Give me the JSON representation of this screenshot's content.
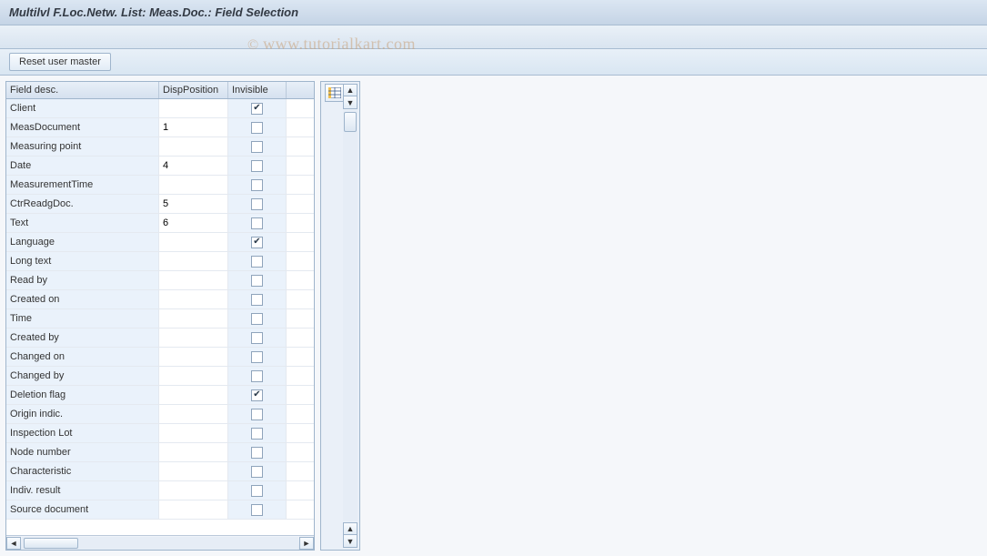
{
  "window": {
    "title": "Multilvl F.Loc.Netw. List: Meas.Doc.: Field Selection"
  },
  "toolbar": {
    "reset_label": "Reset user master"
  },
  "table": {
    "headers": {
      "field": "Field desc.",
      "disp": "DispPosition",
      "inv": "Invisible"
    },
    "rows": [
      {
        "field": "Client",
        "disp": "",
        "inv": true
      },
      {
        "field": "MeasDocument",
        "disp": "1",
        "inv": false
      },
      {
        "field": "Measuring point",
        "disp": "",
        "inv": false
      },
      {
        "field": "Date",
        "disp": "4",
        "inv": false
      },
      {
        "field": "MeasurementTime",
        "disp": "",
        "inv": false
      },
      {
        "field": "CtrReadgDoc.",
        "disp": "5",
        "inv": false
      },
      {
        "field": "Text",
        "disp": "6",
        "inv": false
      },
      {
        "field": "Language",
        "disp": "",
        "inv": true
      },
      {
        "field": "Long text",
        "disp": "",
        "inv": false
      },
      {
        "field": "Read by",
        "disp": "",
        "inv": false
      },
      {
        "field": "Created on",
        "disp": "",
        "inv": false
      },
      {
        "field": "Time",
        "disp": "",
        "inv": false
      },
      {
        "field": "Created by",
        "disp": "",
        "inv": false
      },
      {
        "field": "Changed on",
        "disp": "",
        "inv": false
      },
      {
        "field": "Changed by",
        "disp": "",
        "inv": false
      },
      {
        "field": "Deletion flag",
        "disp": "",
        "inv": true
      },
      {
        "field": "Origin indic.",
        "disp": "",
        "inv": false
      },
      {
        "field": "Inspection Lot",
        "disp": "",
        "inv": false
      },
      {
        "field": "Node number",
        "disp": "",
        "inv": false
      },
      {
        "field": "Characteristic",
        "disp": "",
        "inv": false
      },
      {
        "field": "Indiv. result",
        "disp": "",
        "inv": false
      },
      {
        "field": "Source document",
        "disp": "",
        "inv": false
      }
    ]
  },
  "watermark": {
    "text": "www.tutorialkart.com",
    "prefix": "© "
  }
}
